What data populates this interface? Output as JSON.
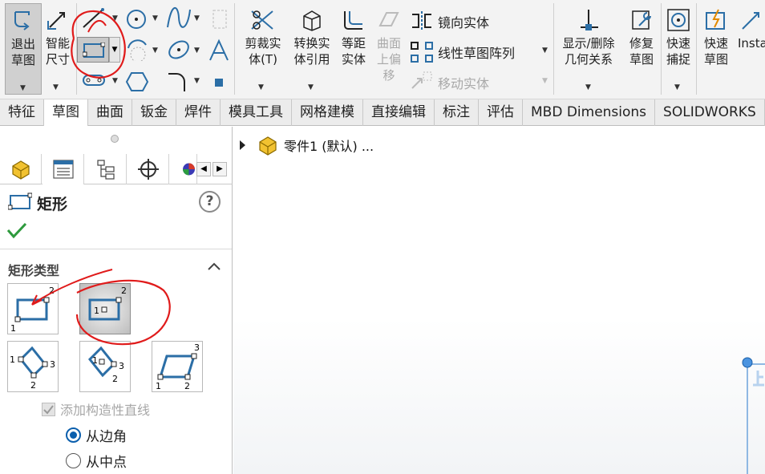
{
  "ribbon": {
    "exit_sketch": [
      "退出",
      "草图"
    ],
    "smart_dim": [
      "智能",
      "尺寸"
    ],
    "trim": [
      "剪裁实",
      "体(T)"
    ],
    "convert": [
      "转换实",
      "体引用"
    ],
    "offset": [
      "等距",
      "实体"
    ],
    "surface_offset": [
      "曲面",
      "上偏",
      "移"
    ],
    "mirror": "镜向实体",
    "linear_pattern": "线性草图阵列",
    "move": "移动实体",
    "display_delete": [
      "显示/删除",
      "几何关系"
    ],
    "repair": [
      "修复",
      "草图"
    ],
    "quick_snap": [
      "快速",
      "捕捉"
    ],
    "rapid_sketch": [
      "快速",
      "草图"
    ],
    "instant": "Insta"
  },
  "tabs": [
    "特征",
    "草图",
    "曲面",
    "钣金",
    "焊件",
    "模具工具",
    "网格建模",
    "直接编辑",
    "标注",
    "评估",
    "MBD Dimensions",
    "SOLIDWORKS"
  ],
  "active_tab": "草图",
  "panel": {
    "title": "矩形",
    "help": "?",
    "group_title": "矩形类型",
    "add_construction": "添加构造性直线",
    "from_corner": "从边角",
    "from_center": "从中点"
  },
  "tree": {
    "part": "零件1 (默认) ..."
  },
  "rect_types": {
    "corner_labels": [
      "1",
      "2"
    ],
    "center_labels": [
      "1",
      "2"
    ],
    "three_corner_labels": [
      "1",
      "2",
      "3"
    ],
    "three_center_labels": [
      "1",
      "2",
      "3"
    ],
    "parallelogram_labels": [
      "1",
      "2",
      "3"
    ]
  },
  "colors": {
    "accent": "#2b6ea6",
    "annotation": "#e01b1b",
    "check": "#2e9a3d"
  }
}
